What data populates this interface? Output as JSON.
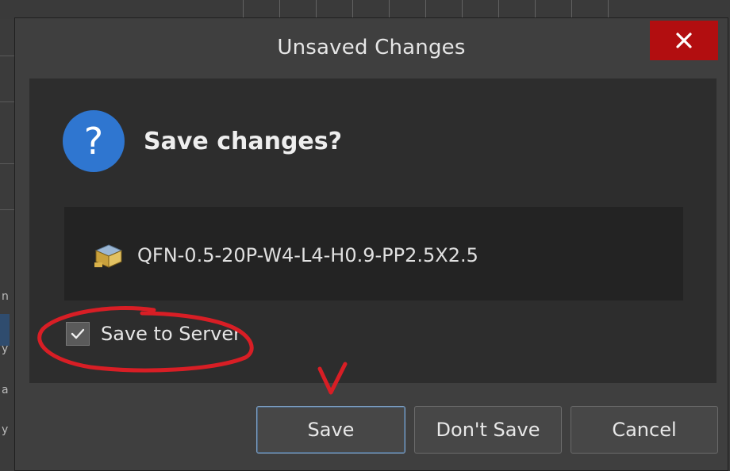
{
  "dialog": {
    "title": "Unsaved Changes",
    "close_icon": "close-icon",
    "close_color": "#b20e10",
    "heading": "Save changes?",
    "question_icon": "question-icon",
    "question_symbol": "?",
    "question_color": "#2f76d0",
    "file": {
      "icon": "component-icon",
      "name": "QFN-0.5-20P-W4-L4-H0.9-PP2.5X2.5"
    },
    "save_to_server": {
      "label": "Save to Server",
      "checked": true
    },
    "buttons": {
      "save": "Save",
      "dont_save": "Don't Save",
      "cancel": "Cancel"
    },
    "annotation_color": "#d81e25"
  },
  "background": {
    "left_fragments": [
      "n",
      "y",
      "a",
      "y"
    ]
  }
}
